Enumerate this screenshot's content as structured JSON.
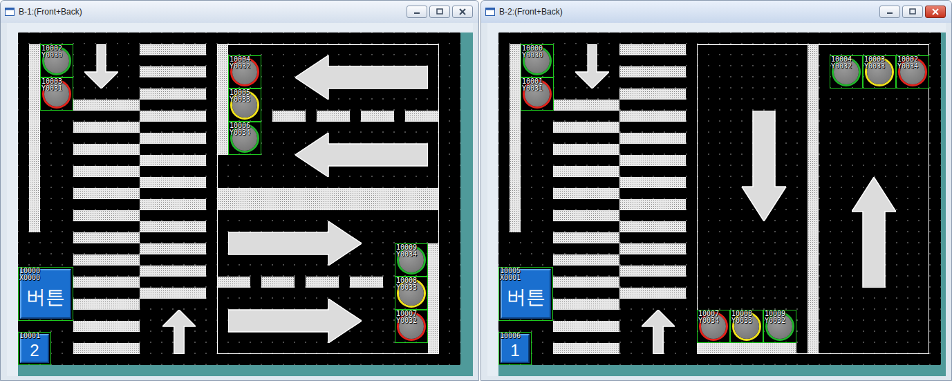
{
  "windows": [
    {
      "title": "B-1:(Front+Back)",
      "active": false,
      "lamps": [
        {
          "tag": "10002",
          "address": "Y0030",
          "color": "#21b52b",
          "lit": false
        },
        {
          "tag": "10003",
          "address": "Y0031",
          "color": "#e3221b",
          "lit": false
        },
        {
          "tag": "10004",
          "address": "Y0032",
          "color": "#e3221b",
          "lit": false
        },
        {
          "tag": "10005",
          "address": "Y0033",
          "color": "#f2e21a",
          "lit": false
        },
        {
          "tag": "10006",
          "address": "Y0034",
          "color": "#21b52b",
          "lit": false
        },
        {
          "tag": "10009",
          "address": "Y0034",
          "color": "#21b52b",
          "lit": false
        },
        {
          "tag": "10008",
          "address": "Y0033",
          "color": "#f2e21a",
          "lit": false
        },
        {
          "tag": "10007",
          "address": "Y0032",
          "color": "#e3221b",
          "lit": false
        }
      ],
      "main_button": {
        "label": "버튼",
        "tag": "10000",
        "address": "X0000"
      },
      "screen_button": {
        "label": "2",
        "tag": "10001"
      }
    },
    {
      "title": "B-2:(Front+Back)",
      "active": true,
      "lamps": [
        {
          "tag": "10000",
          "address": "Y0030",
          "color": "#21b52b",
          "lit": false
        },
        {
          "tag": "10001",
          "address": "Y0031",
          "color": "#e3221b",
          "lit": false
        },
        {
          "tag": "10004",
          "address": "Y0032",
          "color": "#21b52b",
          "lit": false
        },
        {
          "tag": "10003",
          "address": "Y0033",
          "color": "#f2e21a",
          "lit": false
        },
        {
          "tag": "10002",
          "address": "Y0034",
          "color": "#e3221b",
          "lit": false
        },
        {
          "tag": "10007",
          "address": "Y0034",
          "color": "#e3221b",
          "lit": false
        },
        {
          "tag": "10008",
          "address": "Y0033",
          "color": "#f2e21a",
          "lit": false
        },
        {
          "tag": "10009",
          "address": "Y0032",
          "color": "#21b52b",
          "lit": false
        }
      ],
      "main_button": {
        "label": "버튼",
        "tag": "10005",
        "address": "X0001"
      },
      "screen_button": {
        "label": "1",
        "tag": "10006"
      }
    }
  ]
}
